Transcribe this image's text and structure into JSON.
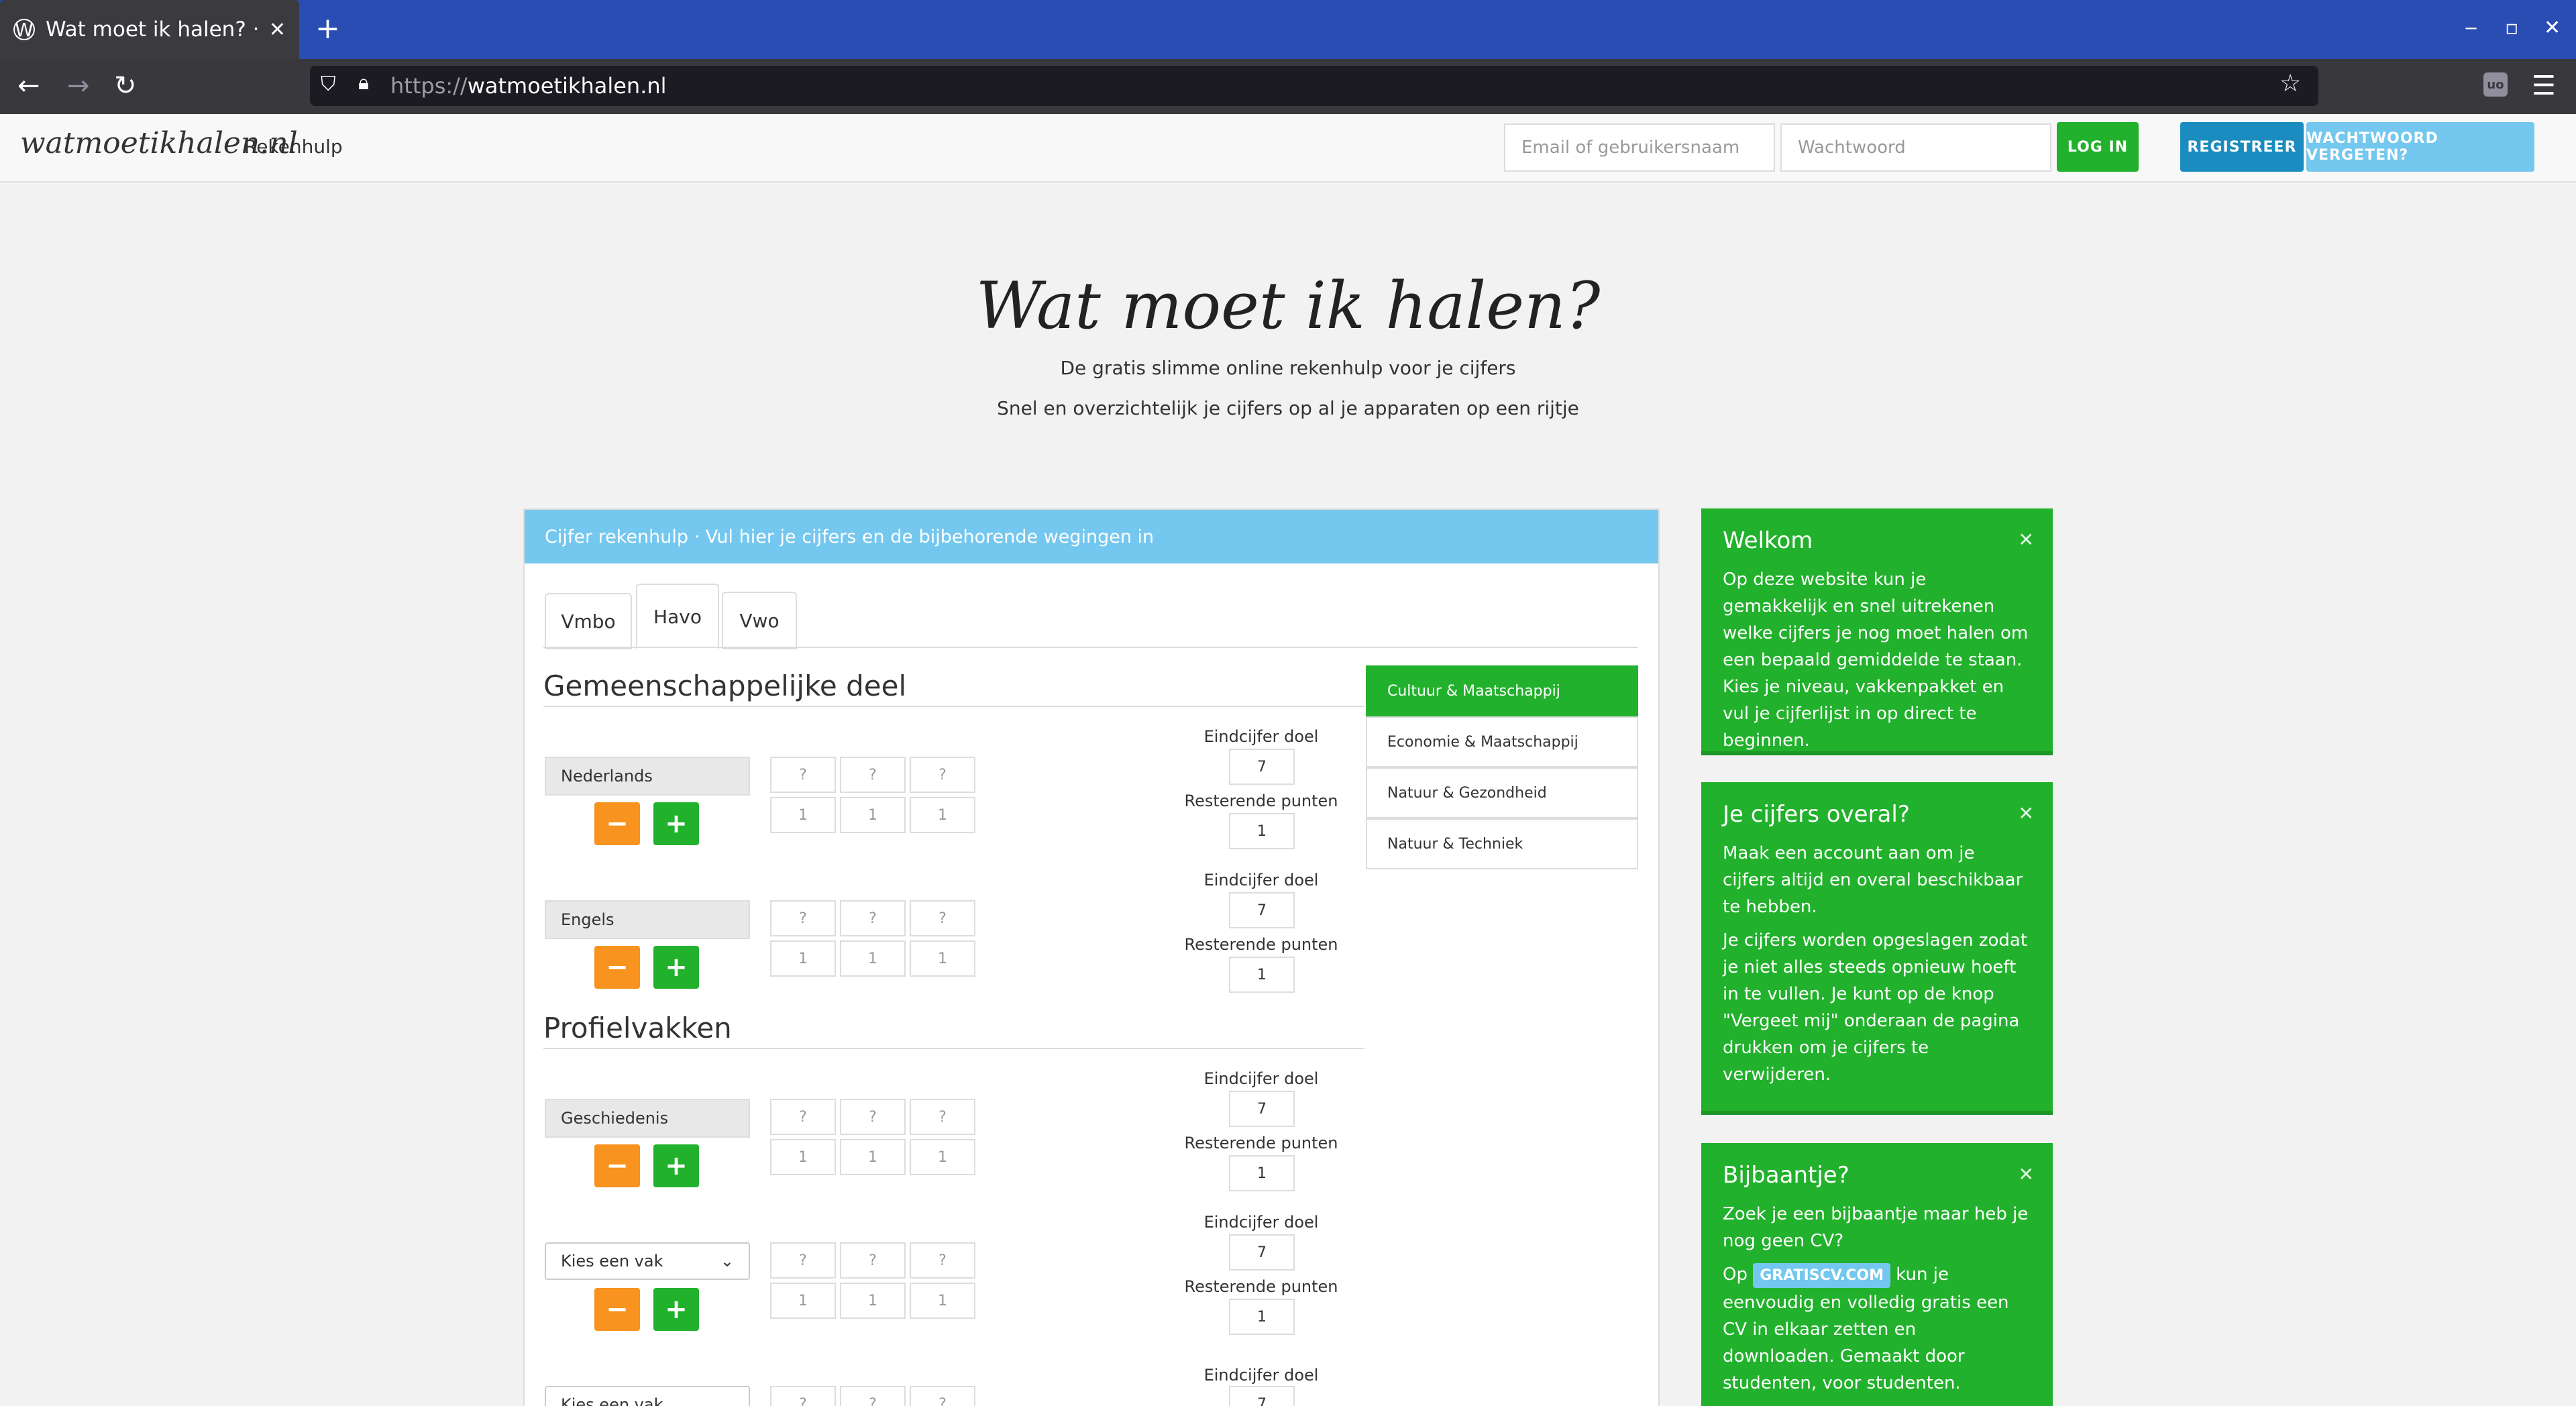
{
  "browser": {
    "tab_title": "Wat moet ik halen? · De sl",
    "tab_close": "✕",
    "new_tab": "+",
    "url_protocol": "https://",
    "url_host": "watmoetikhalen.nl",
    "window_min": "‒",
    "window_max": "▫",
    "window_close": "✕"
  },
  "site": {
    "logo": "watmoetikhalen.nl",
    "nav_link": "Rekenhulp",
    "email_placeholder": "Email of gebruikersnaam",
    "password_placeholder": "Wachtwoord",
    "login": "LOG IN",
    "register": "REGISTREER",
    "forgot": "WACHTWOORD VERGETEN?"
  },
  "hero": {
    "title": "Wat moet ik halen?",
    "sub1": "De gratis slimme online rekenhulp voor je cijfers",
    "sub2": "Snel en overzichtelijk je cijfers op al je apparaten op een rijtje"
  },
  "panel": {
    "header": "Cijfer rekenhulp · Vul hier je cijfers en de bijbehorende wegingen in",
    "tabs": [
      "Vmbo",
      "Havo",
      "Vwo"
    ],
    "section1": "Gemeenschappelijke deel",
    "section2": "Profielvakken",
    "grade_placeholder": "?",
    "weight": "1",
    "goal_label": "Eindcijfer doel",
    "goal_value": "7",
    "remaining_label": "Resterende punten",
    "remaining_value": "1",
    "minus": "−",
    "plus": "+",
    "subjects": [
      "Nederlands",
      "Engels",
      "Geschiedenis"
    ],
    "select_placeholder": "Kies een vak",
    "profiles": [
      "Cultuur & Maatschappij",
      "Economie & Maatschappij",
      "Natuur & Gezondheid",
      "Natuur & Techniek"
    ]
  },
  "sidebar": {
    "close": "✕",
    "welkom_title": "Welkom",
    "welkom_text": "Op deze website kun je gemakkelijk en snel uitrekenen welke cijfers je nog moet halen om een bepaald gemiddelde te staan. Kies je niveau, vakkenpakket en vul je cijferlijst in op direct te beginnen.",
    "overal_title": "Je cijfers overal?",
    "overal_text1": "Maak een account aan om je cijfers altijd en overal beschikbaar te hebben.",
    "overal_text2": "Je cijfers worden opgeslagen zodat je niet alles steeds opnieuw hoeft in te vullen. Je kunt op de knop \"Vergeet mij\" onderaan de pagina drukken om je cijfers te verwijderen.",
    "bijbaan_title": "Bijbaantje?",
    "bijbaan_text1": "Zoek je een bijbaantje maar heb je nog geen CV?",
    "bijbaan_op": "Op",
    "bijbaan_badge": "GRATISCV.COM",
    "bijbaan_text2": "kun je eenvoudig en volledig gratis een CV in elkaar zetten en downloaden. Gemaakt door studenten, voor studenten."
  },
  "colors": {
    "green": "#22b12c",
    "orange": "#f7931e",
    "lightblue": "#74c7ee",
    "blue": "#1a8cbf"
  }
}
